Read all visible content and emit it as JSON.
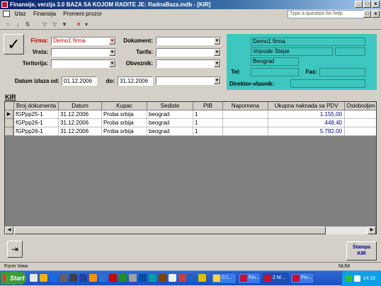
{
  "window": {
    "title": "Finansije, verzija 3.0      BAZA SA KOJOM RADITE JE: RadnaBaza.mdb - [KIR]",
    "minimize": "_",
    "maximize": "□",
    "close": "x",
    "doc_min": "_",
    "doc_max": "□",
    "doc_close": "x"
  },
  "menu": {
    "items": [
      "Izlaz",
      "Finansija",
      "Promeni prozor"
    ],
    "help_placeholder": "Type a question for help"
  },
  "filters": {
    "firma_label": "Firma:",
    "firma_value": "Demo1 firma",
    "vrsta_label": "Vrsta:",
    "vrsta_value": "",
    "teritorija_label": "Teritorija:",
    "teritorija_value": "",
    "dokument_label": "Dokument:",
    "dokument_value": "",
    "tarifa_label": "Tarifa:",
    "tarifa_value": "",
    "obveznik_label": "Obveznik:",
    "obveznik_value": "",
    "datum_label": "Datum izlaza od:",
    "datum_od": "01.12.2006",
    "do_label": "do:",
    "datum_do": "31.12.2006",
    "extra_value": ""
  },
  "company": {
    "name": "Demo1 firma",
    "street": "Vojvode Stepe",
    "city": "Beograd",
    "tel_label": "Tel:",
    "tel": "",
    "fax_label": "Fax:",
    "fax": "",
    "director_label": "Direktor-vlasnik:",
    "director": ""
  },
  "section_title": "KIR",
  "table": {
    "columns": [
      "Broj dokumenta",
      "Datum",
      "Kupac",
      "Sediste",
      "PIB",
      "Napomena",
      "Ukupna naknada sa PDV",
      "Oslobodjen"
    ],
    "rows": [
      [
        "fGPpp25-1",
        "31.12.2006",
        "Proba srbija",
        "beograd",
        "1",
        "",
        "1.155,00",
        ""
      ],
      [
        "fGPpp26-1",
        "31.12.2006",
        "Proba srbija",
        "beograd",
        "1",
        "",
        "448,40",
        ""
      ],
      [
        "fGPpp26-1",
        "31.12.2006",
        "Proba srbija",
        "beograd",
        "1",
        "",
        "5.782,00",
        ""
      ]
    ]
  },
  "buttons": {
    "print_line1": "Štampa",
    "print_line2": "KIR"
  },
  "status": {
    "left": "Form View",
    "right": "NUM"
  },
  "taskbar": {
    "start": "Start",
    "tasks": [
      "C:\\...",
      "Fin...",
      "2 M...",
      "Fin..."
    ],
    "clock": "14:15"
  },
  "colors": {
    "panel": "#3ec7c0",
    "title": "#0a246a",
    "firma_label": "#c00000"
  }
}
